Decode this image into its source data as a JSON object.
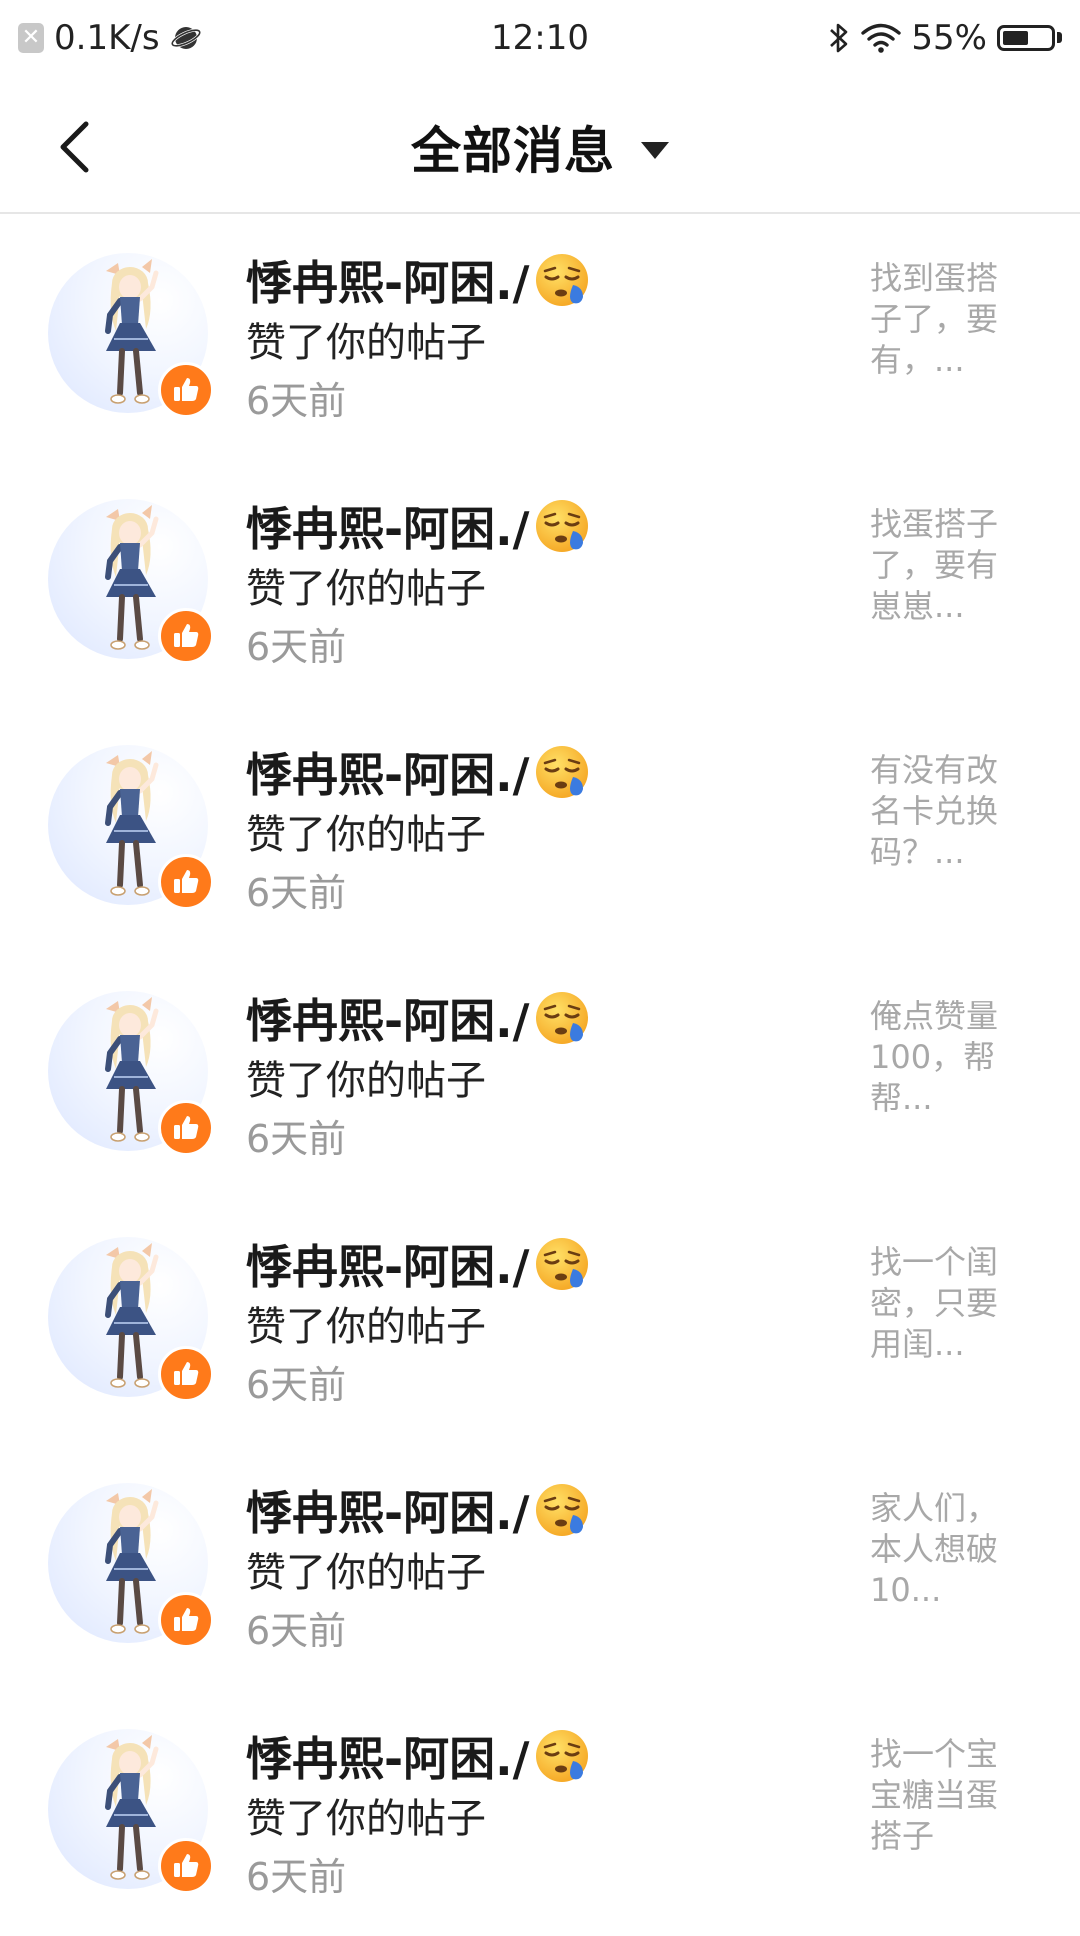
{
  "status_bar": {
    "net_speed": "0.1K/s",
    "time": "12:10",
    "battery": "55%",
    "battery_level": 0.55
  },
  "header": {
    "title": "全部消息"
  },
  "messages": [
    {
      "name": "悸冉熙-阿困./",
      "action": "赞了你的帖子",
      "time": "6天前",
      "preview": "找到蛋搭子了，要有，..."
    },
    {
      "name": "悸冉熙-阿困./",
      "action": "赞了你的帖子",
      "time": "6天前",
      "preview": "找蛋搭子了，要有崽崽..."
    },
    {
      "name": "悸冉熙-阿困./",
      "action": "赞了你的帖子",
      "time": "6天前",
      "preview": "有没有改名卡兑换码？..."
    },
    {
      "name": "悸冉熙-阿困./",
      "action": "赞了你的帖子",
      "time": "6天前",
      "preview": "俺点赞量100，帮帮..."
    },
    {
      "name": "悸冉熙-阿困./",
      "action": "赞了你的帖子",
      "time": "6天前",
      "preview": "找一个闺密，只要用闺..."
    },
    {
      "name": "悸冉熙-阿困./",
      "action": "赞了你的帖子",
      "time": "6天前",
      "preview": "家人们，本人想破10..."
    },
    {
      "name": "悸冉熙-阿困./",
      "action": "赞了你的帖子",
      "time": "6天前",
      "preview": "找一个宝宝糖当蛋搭子"
    }
  ],
  "icons": {
    "badge": "thumbs-up-icon",
    "emoji": "sleepy-face-icon",
    "back": "back-arrow-icon"
  },
  "colors": {
    "accent": "#ff7a1a",
    "secondary_text": "#9a9a9a"
  }
}
